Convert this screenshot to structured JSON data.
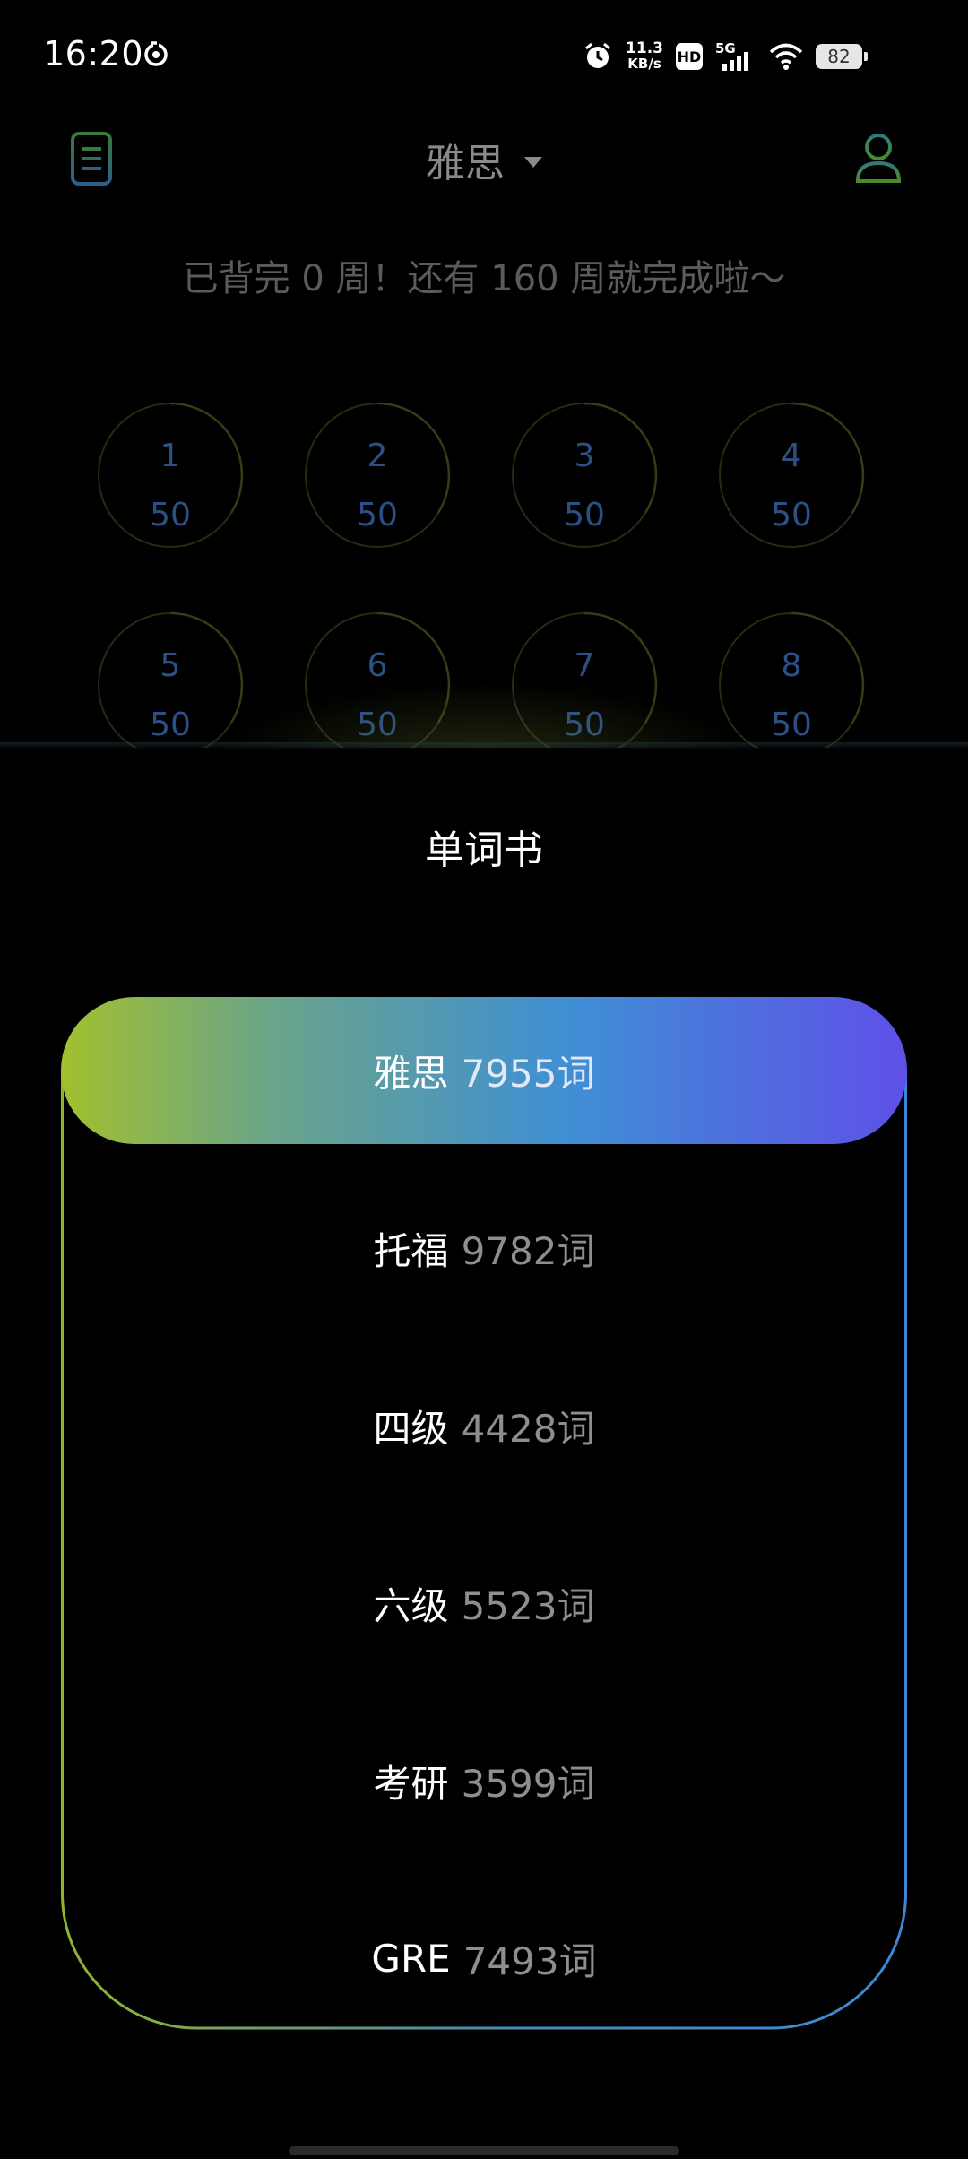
{
  "status_bar": {
    "time": "16:20",
    "net_speed_value": "11.3",
    "net_speed_unit": "KB/s",
    "hd_label": "HD",
    "network_label": "5G",
    "battery_level": "82",
    "icons": [
      "sync-icon",
      "alarm-icon",
      "hd-icon",
      "signal-icon",
      "wifi-icon",
      "battery-icon"
    ]
  },
  "header": {
    "title": "雅思",
    "menu_icon": "menu-list-icon",
    "profile_icon": "user-profile-icon"
  },
  "progress_text": "已背完 0 周！还有 160 周就完成啦～",
  "weeks": [
    {
      "num": "1",
      "count": "50"
    },
    {
      "num": "2",
      "count": "50"
    },
    {
      "num": "3",
      "count": "50"
    },
    {
      "num": "4",
      "count": "50"
    },
    {
      "num": "5",
      "count": "50"
    },
    {
      "num": "6",
      "count": "50"
    },
    {
      "num": "7",
      "count": "50"
    },
    {
      "num": "8",
      "count": "50"
    }
  ],
  "sheet": {
    "title": "单词书",
    "books": [
      {
        "name": "雅思",
        "count": "7955词",
        "selected": true
      },
      {
        "name": "托福",
        "count": "9782词",
        "selected": false
      },
      {
        "name": "四级",
        "count": "4428词",
        "selected": false
      },
      {
        "name": "六级",
        "count": "5523词",
        "selected": false
      },
      {
        "name": "考研",
        "count": "3599词",
        "selected": false
      },
      {
        "name": "GRE",
        "count": "7493词",
        "selected": false
      }
    ]
  },
  "colors": {
    "gradient_start": "#a2c02e",
    "gradient_mid": "#3f8fd4",
    "gradient_end": "#5e50e8",
    "week_text": "#2c4f86",
    "dim_text": "#5b5b5b"
  }
}
